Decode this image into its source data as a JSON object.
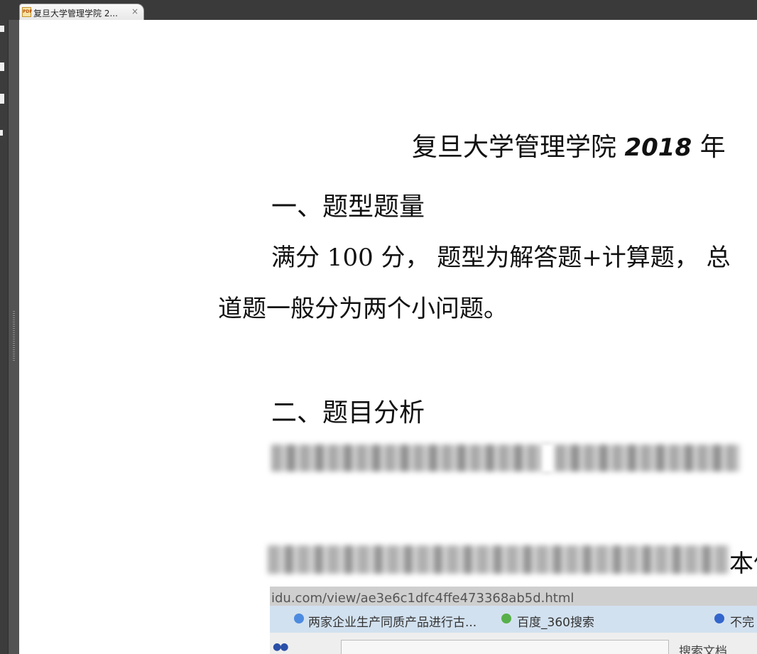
{
  "tab": {
    "icon_text": "PDF",
    "title": "复旦大学管理学院 2...",
    "close": "×"
  },
  "document": {
    "title_prefix": "复旦大学管理学院",
    "title_year": "2018",
    "title_suffix": "年",
    "section1_heading": "一、题型题量",
    "section1_line1": "满分  100  分，  题型为解答题+计算题，  总",
    "section1_line2": "道题一般分为两个小问题。",
    "section2_heading": "二、题目分析",
    "blurred_line_tail": "本信"
  },
  "photo": {
    "url": "idu.com/view/ae3e6c1dfc4ffe473368ab5d.html",
    "bookmark1": "两家企业生产同质产品进行古...",
    "bookmark2": "百度_360搜索",
    "bookmark3": "不完",
    "search_text": "搜索文档"
  }
}
